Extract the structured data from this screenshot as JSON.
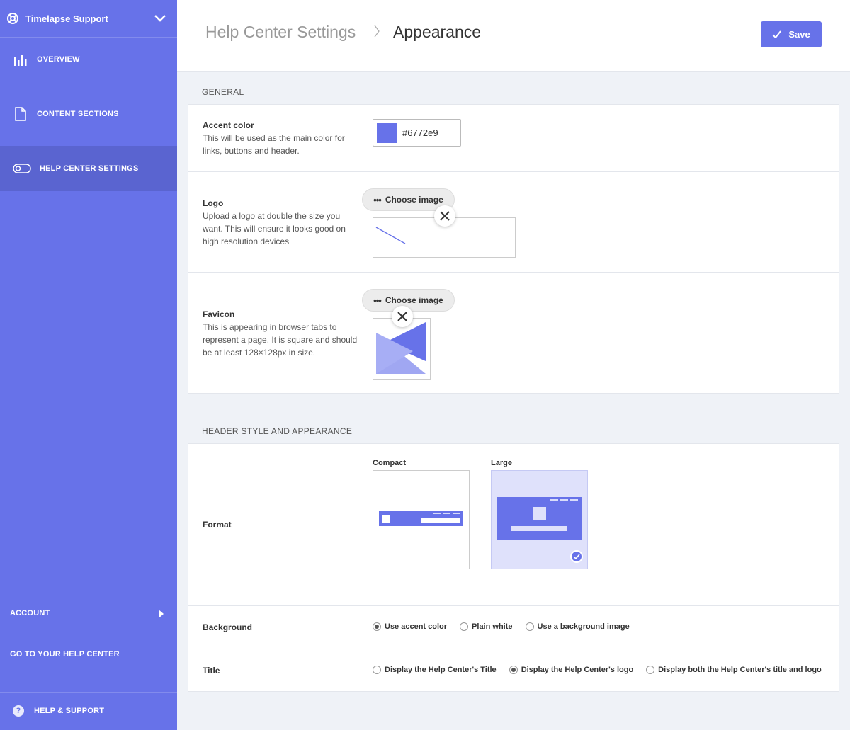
{
  "sidebar": {
    "app_title": "Timelapse Support",
    "items": [
      {
        "label": "OVERVIEW",
        "icon": "bar-chart-icon"
      },
      {
        "label": "CONTENT SECTIONS",
        "icon": "document-icon"
      },
      {
        "label": "HELP CENTER SETTINGS",
        "icon": "toggle-icon",
        "active": true
      }
    ],
    "account_label": "ACCOUNT",
    "go_to_help_center_label": "GO TO YOUR HELP CENTER",
    "help_support_label": "HELP & SUPPORT"
  },
  "header": {
    "breadcrumb_parent": "Help Center Settings",
    "breadcrumb_current": "Appearance",
    "save_label": "Save"
  },
  "general": {
    "section_title": "GENERAL",
    "accent": {
      "label": "Accent color",
      "description": "This will be used as the main color for links, buttons and header.",
      "value": "#6772e9"
    },
    "logo": {
      "label": "Logo",
      "description": "Upload a logo at double the size you want. This will ensure it looks good on high resolution devices",
      "choose_label": "Choose image"
    },
    "favicon": {
      "label": "Favicon",
      "description": "This is appearing in browser tabs to represent a page. It is square and should be at least 128×128px in size.",
      "choose_label": "Choose image"
    }
  },
  "header_style": {
    "section_title": "HEADER STYLE AND APPEARANCE",
    "format": {
      "label": "Format",
      "options": [
        "Compact",
        "Large"
      ],
      "selected": "Large"
    },
    "background": {
      "label": "Background",
      "options": [
        "Use accent color",
        "Plain white",
        "Use a background image"
      ],
      "selected": "Use accent color"
    },
    "title": {
      "label": "Title",
      "options": [
        "Display the Help Center's Title",
        "Display the Help Center's logo",
        "Display both the Help Center's title and logo"
      ],
      "selected": "Display the Help Center's logo"
    }
  },
  "colors": {
    "accent": "#6772e9",
    "sidebar_active": "#5a64d0",
    "page_bg": "#eff2f7"
  }
}
